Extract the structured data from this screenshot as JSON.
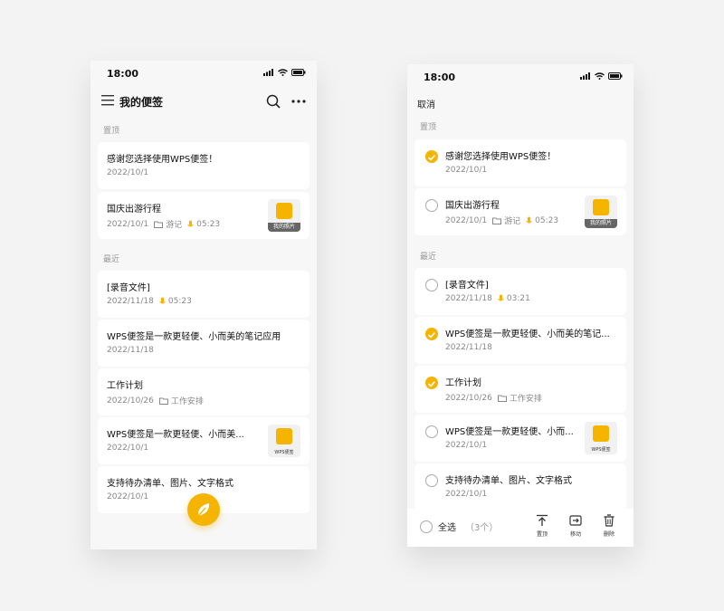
{
  "left": {
    "status_time": "18:00",
    "title": "我的便签",
    "section_pinned": "置顶",
    "section_recent": "最近",
    "pinned": [
      {
        "title": "感谢您选择使用WPS便签！",
        "date": "2022/10/1"
      },
      {
        "title": "国庆出游行程",
        "date": "2022/10/1",
        "folder": "游记",
        "audio": "05:23",
        "thumb_label": "我的照片"
      }
    ],
    "recent": [
      {
        "title": "[录音文件]",
        "date": "2022/11/18",
        "audio": "05:23"
      },
      {
        "title": "WPS便签是一款更轻便、小而美的笔记应用",
        "date": "2022/11/18"
      },
      {
        "title": "工作计划",
        "date": "2022/10/26",
        "folder": "工作安排"
      },
      {
        "title": "WPS便签是一款更轻便、小而美...",
        "date": "2022/10/1",
        "thumb_caption": "WPS便签"
      },
      {
        "title": "支持待办清单、图片、文字格式",
        "date": "2022/10/1"
      }
    ]
  },
  "right": {
    "status_time": "18:00",
    "cancel": "取消",
    "section_pinned": "置顶",
    "section_recent": "最近",
    "pinned": [
      {
        "title": "感谢您选择使用WPS便签！",
        "date": "2022/10/1",
        "checked": true
      },
      {
        "title": "国庆出游行程",
        "date": "2022/10/1",
        "folder": "游记",
        "audio": "05:23",
        "thumb_label": "我的照片",
        "checked": false
      }
    ],
    "recent": [
      {
        "title": "[录音文件]",
        "date": "2022/11/18",
        "audio": "03:21",
        "checked": false
      },
      {
        "title": "WPS便签是一款更轻便、小而美的笔记...",
        "date": "2022/11/18",
        "checked": true
      },
      {
        "title": "工作计划",
        "date": "2022/10/26",
        "folder": "工作安排",
        "checked": true
      },
      {
        "title": "WPS便签是一款更轻便、小而...",
        "date": "2022/10/1",
        "thumb_caption": "WPS便签",
        "checked": false
      },
      {
        "title": "支持待办清单、图片、文字格式",
        "date": "2022/10/1",
        "checked": false
      }
    ],
    "bottom": {
      "select_all": "全选",
      "count": "（3个）",
      "pin": "置顶",
      "move": "移动",
      "delete": "删除"
    }
  },
  "colors": {
    "accent": "#f4b400"
  },
  "icons": [
    "menu-icon",
    "search-icon",
    "more-icon",
    "folder-icon",
    "mic-icon",
    "leaf-icon",
    "check-icon",
    "pin-icon",
    "move-icon",
    "trash-icon"
  ]
}
